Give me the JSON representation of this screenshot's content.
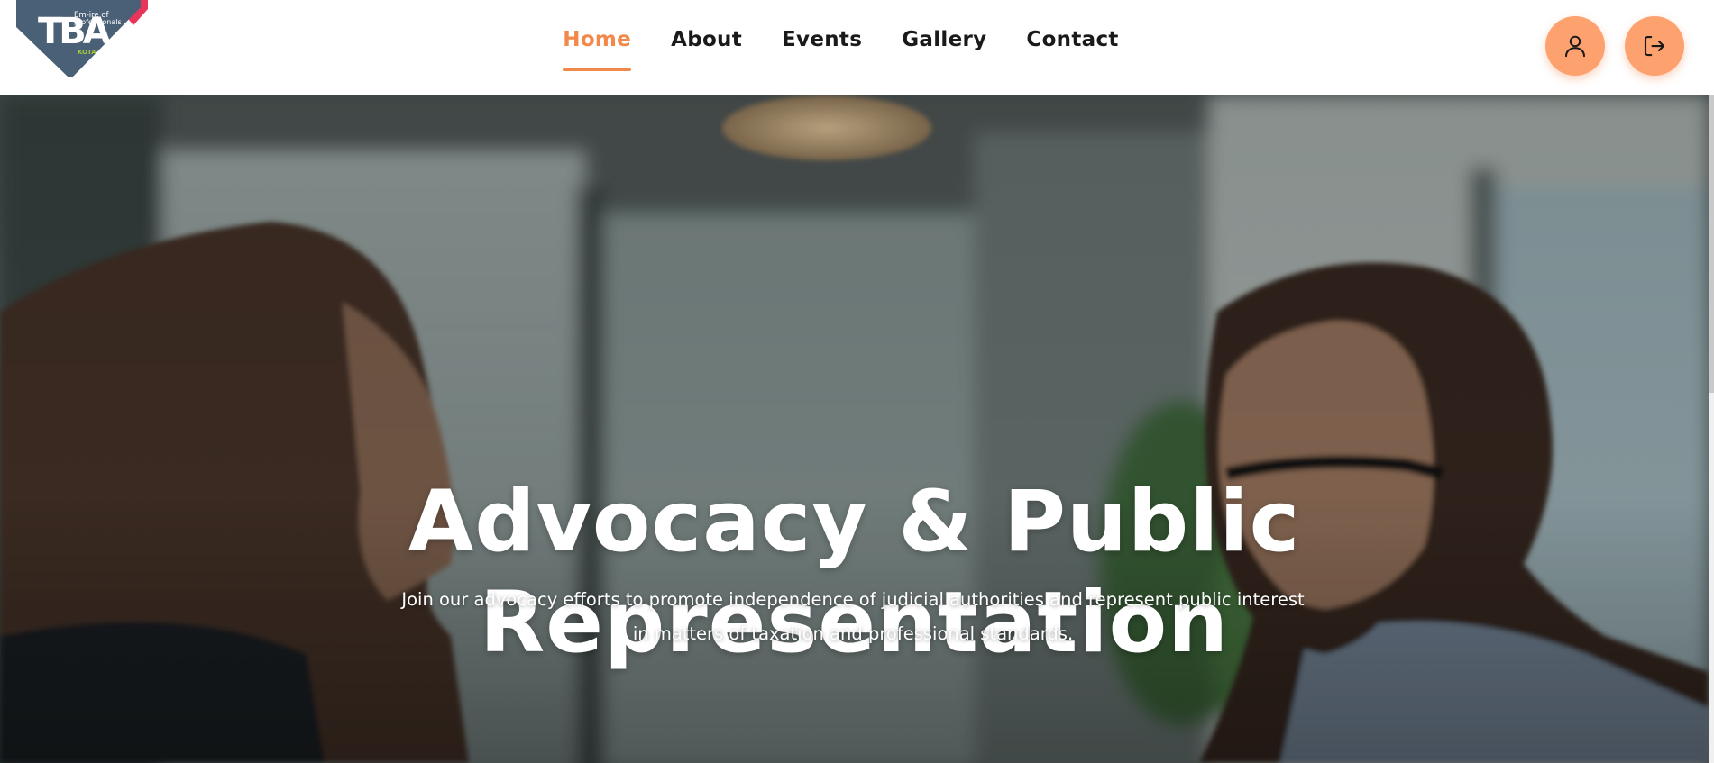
{
  "logo": {
    "mark": "TBA",
    "tagline_line1": "Em-ire of",
    "tagline_line2": "professionals",
    "city": "KOTA"
  },
  "nav": {
    "items": [
      {
        "label": "Home",
        "active": true
      },
      {
        "label": "About",
        "active": false
      },
      {
        "label": "Events",
        "active": false
      },
      {
        "label": "Gallery",
        "active": false
      },
      {
        "label": "Contact",
        "active": false
      }
    ]
  },
  "actions": {
    "profile_icon": "user-icon",
    "logout_icon": "logout-icon"
  },
  "hero": {
    "title_line1": "Advocacy & Public",
    "title_line2": "Representation",
    "subtitle_line1": "Join our advocacy efforts to promote independence of judicial authorities and represent public interest",
    "subtitle_line2": "in matters of taxation and professional standards."
  },
  "colors": {
    "accent": "#f2894b",
    "button_bg": "#fda26f",
    "logo_bg": "#4a6076",
    "logo_accent": "#e8365a",
    "logo_green": "#a6c93a"
  }
}
